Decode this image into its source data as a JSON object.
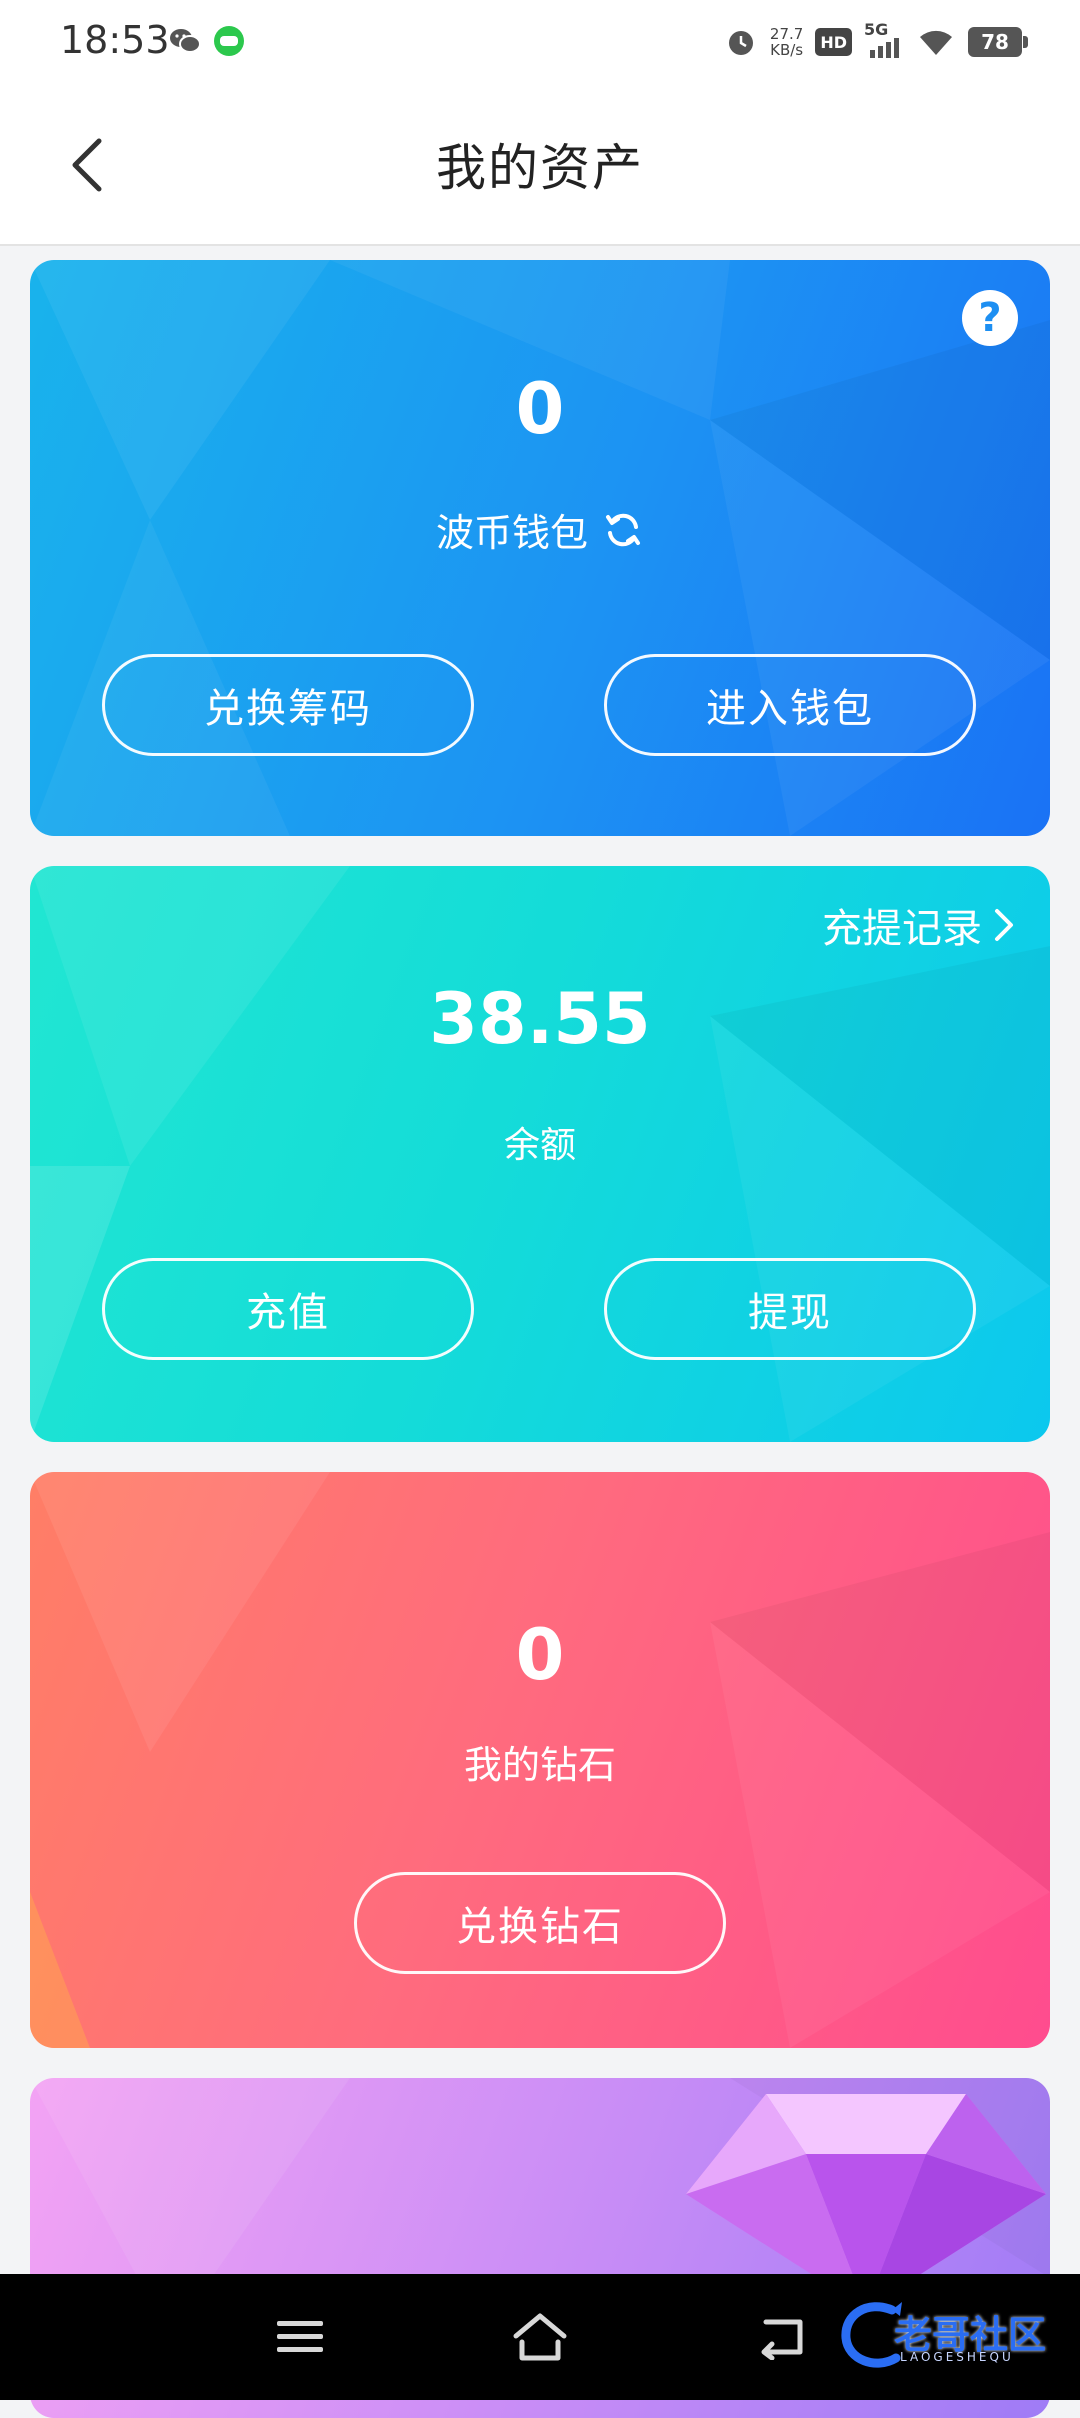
{
  "status_bar": {
    "time": "18:53",
    "net_speed_value": "27.7",
    "net_speed_unit": "KB/s",
    "hd_badge": "HD",
    "network_type": "5G",
    "battery_level": "78",
    "icons": [
      "wechat-icon",
      "message-icon",
      "alarm-icon",
      "signal-icon",
      "wifi-icon",
      "battery-icon"
    ]
  },
  "header": {
    "title": "我的资产",
    "back_icon": "chevron-left-icon"
  },
  "wallet_card": {
    "value": "0",
    "label": "波币钱包",
    "exchange_button": "兑换筹码",
    "enter_button": "进入钱包",
    "colors": [
      "#19b3ec",
      "#1a72f5"
    ]
  },
  "balance_card": {
    "records_link": "充提记录",
    "value": "38.55",
    "label": "余额",
    "recharge_button": "充值",
    "withdraw_button": "提现",
    "colors": [
      "#21e6d2",
      "#0cc8ee"
    ]
  },
  "diamond_card": {
    "value": "0",
    "label": "我的钻石",
    "exchange_button": "兑换钻石",
    "colors": [
      "#ff7e66",
      "#ff4c8e"
    ]
  },
  "fourth_card": {
    "icon": "gem-icon",
    "colors": [
      "#f3a3f4",
      "#9f7bf6"
    ]
  },
  "system_nav": {
    "icons": [
      "menu-icon",
      "home-icon",
      "back-icon"
    ],
    "watermark": "老哥社区",
    "watermark_sub": "LAOGESHEQU"
  }
}
